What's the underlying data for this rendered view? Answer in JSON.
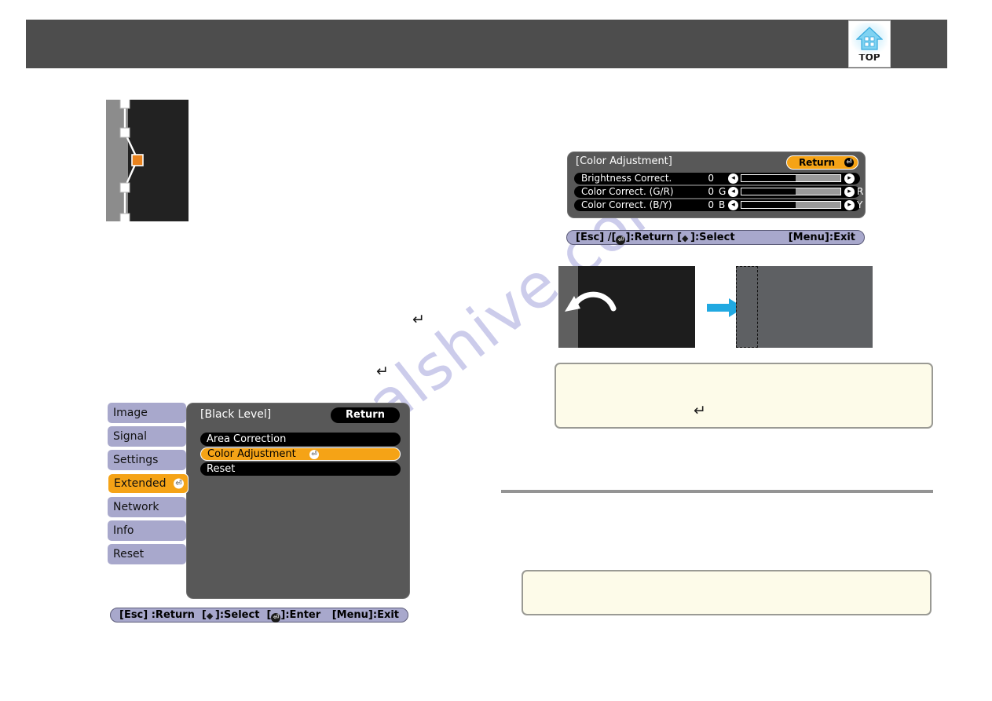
{
  "page": {
    "watermark": "manualshive.com",
    "top_badge": {
      "label": "TOP",
      "icon": "home-top-icon"
    }
  },
  "black_level_menu": {
    "title": "[Black Level]",
    "return_label": "Return",
    "tabs": [
      {
        "label": "Image",
        "selected": false
      },
      {
        "label": "Signal",
        "selected": false
      },
      {
        "label": "Settings",
        "selected": false
      },
      {
        "label": "Extended",
        "selected": true
      },
      {
        "label": "Network",
        "selected": false
      },
      {
        "label": "Info",
        "selected": false
      },
      {
        "label": "Reset",
        "selected": false
      }
    ],
    "items": [
      {
        "label": "Area Correction",
        "highlighted": false,
        "enter": false
      },
      {
        "label": "Color Adjustment",
        "highlighted": true,
        "enter": true
      },
      {
        "label": "Reset",
        "highlighted": false,
        "enter": false
      }
    ],
    "statusbar": {
      "left": "[Esc] :Return  [",
      "select_mid": "]:Select  [",
      "enter_mid": "]:Enter",
      "right": "[Menu]:Exit",
      "esc_text": "[Esc] :Return",
      "select_text": "]:Select",
      "enter_text": "]:Enter"
    }
  },
  "color_adjustment_menu": {
    "title": "[Color Adjustment]",
    "return_label": "Return",
    "rows": [
      {
        "label": "Brightness Correct.",
        "value": "0",
        "channel": "",
        "end_label": "",
        "fill_percent": 55
      },
      {
        "label": "Color Correct. (G/R)",
        "value": "0",
        "channel": "G",
        "end_label": "R",
        "fill_percent": 55
      },
      {
        "label": "Color Correct. (B/Y)",
        "value": "0",
        "channel": "B",
        "end_label": "Y",
        "fill_percent": 55
      }
    ],
    "statusbar": {
      "esc_text": "[Esc] /[",
      "return_text": "]:Return  [",
      "select_text": "]:Select",
      "right": "[Menu]:Exit"
    }
  },
  "illustration": {
    "before_caption": "",
    "after_caption": "",
    "arrow": "right-arrow-icon"
  },
  "notes": {
    "note_1_glyph": "↵",
    "note_2_text": ""
  },
  "body_glyphs": {
    "enter_a": "↵",
    "enter_b": "↵"
  },
  "colors": {
    "header_bar": "#4d4d4d",
    "osd_panel": "#585858",
    "osd_tab": "#a8a8cc",
    "accent_orange": "#f5a316",
    "statusbar": "#a8a8cc",
    "note_bg": "#fdfbe9",
    "note_border": "#9a9a94",
    "arrow_blue": "#21a9e1",
    "rule": "#949494",
    "watermark": "#5656be"
  }
}
